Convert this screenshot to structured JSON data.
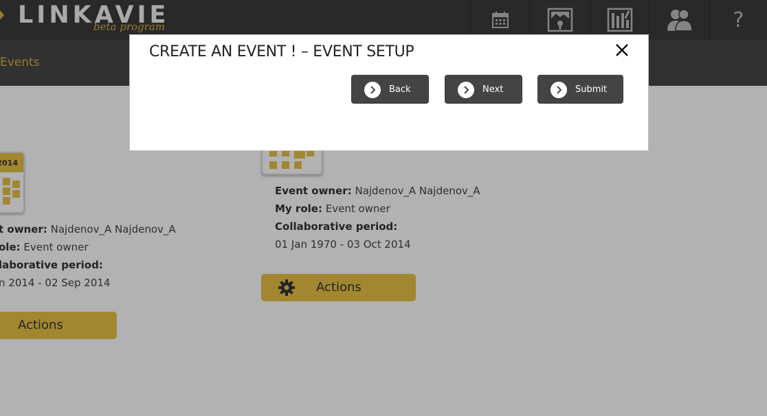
{
  "app": {
    "logo_text": "LINKAVIE",
    "logo_sub": "beta program"
  },
  "topnav": {
    "icons": [
      "calendar-icon",
      "media-gallery-icon",
      "library-shelves-icon",
      "users-icon",
      "help-icon"
    ],
    "help_label": "?"
  },
  "subnav": {
    "current": "Events"
  },
  "events": [
    {
      "year_badge": "2014",
      "owner_label": "t owner:",
      "owner_value": "Najdenov_A Najdenov_A",
      "role_label": "ole:",
      "role_value": "Event owner",
      "period_label": "laborative period:",
      "period_value": "n 2014 - 02 Sep 2014",
      "actions_label": "Actions"
    },
    {
      "owner_label": "Event owner:",
      "owner_value": "Najdenov_A Najdenov_A",
      "role_label": "My role:",
      "role_value": "Event owner",
      "period_label": "Collaborative period:",
      "period_value": "01 Jan 1970 - 03 Oct 2014",
      "actions_label": "Actions"
    }
  ],
  "modal": {
    "title": "CREATE AN EVENT ! – EVENT SETUP",
    "close_icon": "close-icon",
    "back_label": "Back",
    "next_label": "Next",
    "submit_label": "Submit"
  },
  "colors": {
    "accent": "#e9c247",
    "topbar": "#3b3b3b",
    "button_dark": "#444444"
  }
}
